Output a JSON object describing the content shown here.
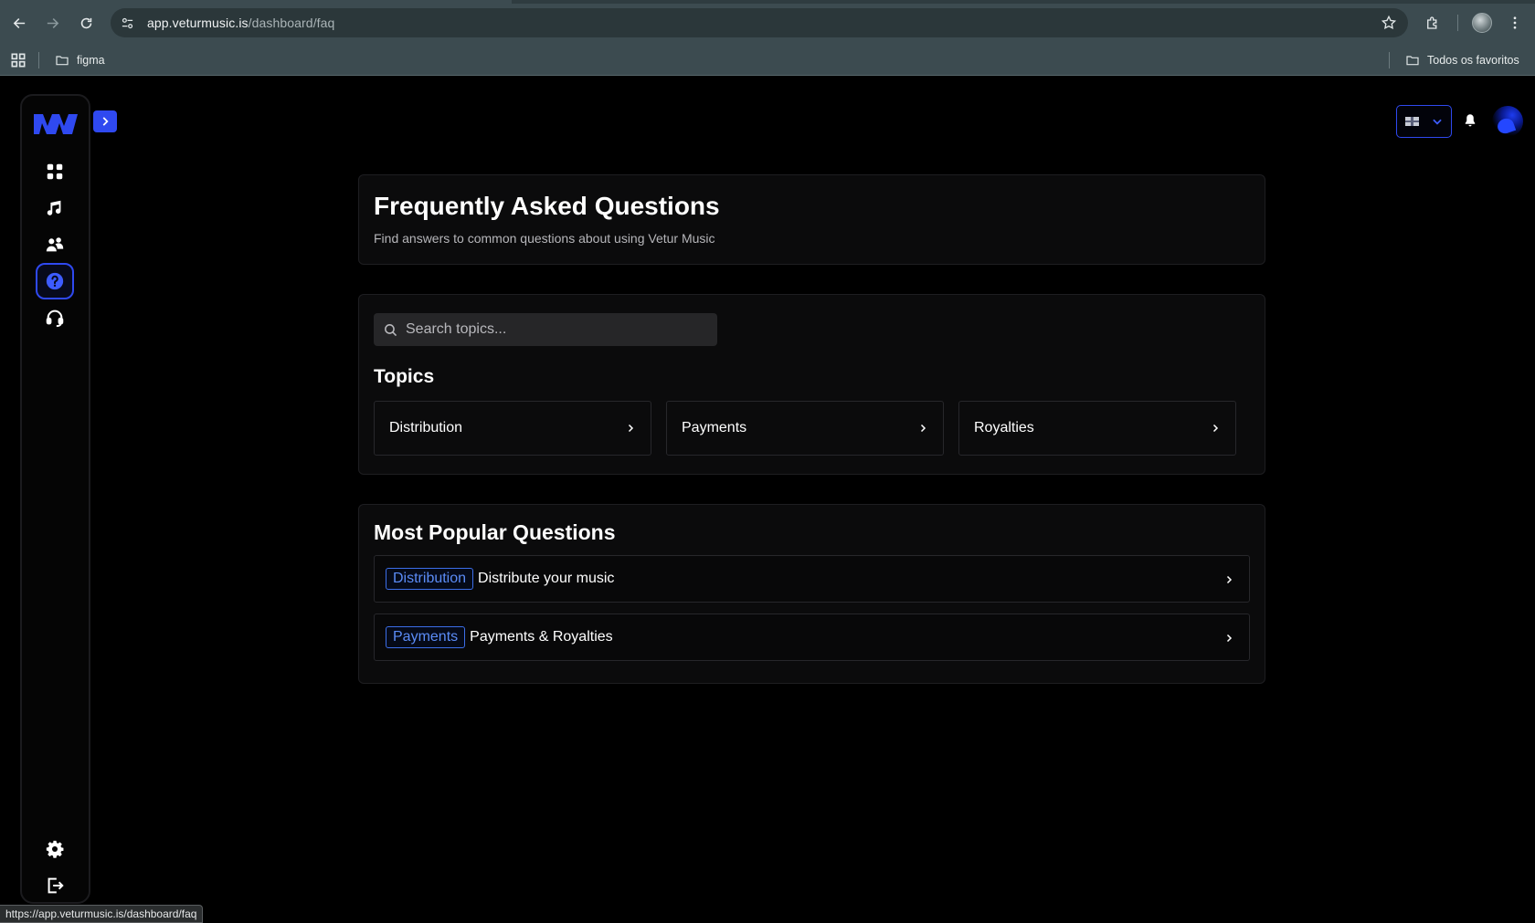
{
  "browser": {
    "url_host": "app.veturmusic.is",
    "url_path": "/dashboard/faq",
    "bookmarks": [
      {
        "label": "figma"
      }
    ],
    "bookmarks_right": {
      "label": "Todos os favoritos"
    },
    "status_url": "https://app.veturmusic.is/dashboard/faq"
  },
  "sidebar": {
    "items": [
      {
        "icon": "dashboard-grid-icon"
      },
      {
        "icon": "music-note-icon"
      },
      {
        "icon": "users-icon"
      },
      {
        "icon": "help-circle-icon",
        "active": true
      },
      {
        "icon": "headphones-support-icon"
      }
    ],
    "bottom_items": [
      {
        "icon": "settings-gear-icon"
      },
      {
        "icon": "logout-icon"
      }
    ]
  },
  "header": {
    "language": "English (UK) flag"
  },
  "faq": {
    "title": "Frequently Asked Questions",
    "subtitle": "Find answers to common questions about using Vetur Music"
  },
  "search": {
    "placeholder": "Search topics..."
  },
  "topics": {
    "label": "Topics",
    "items": [
      {
        "label": "Distribution"
      },
      {
        "label": "Payments"
      },
      {
        "label": "Royalties"
      }
    ]
  },
  "popular": {
    "label": "Most Popular Questions",
    "items": [
      {
        "tag": "Distribution",
        "question": "Distribute your music"
      },
      {
        "tag": "Payments",
        "question": "Payments & Royalties"
      }
    ]
  },
  "colors": {
    "accent": "#2f49f0",
    "badge": "#5b8cf7",
    "background": "#000000",
    "card": "#0b0b0c"
  }
}
